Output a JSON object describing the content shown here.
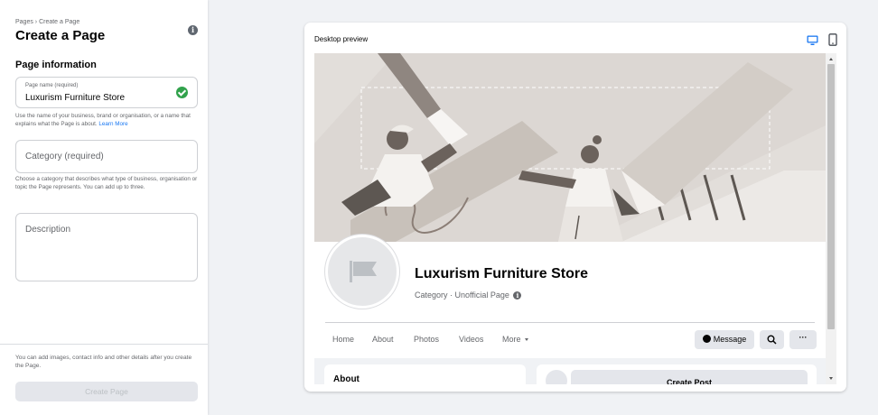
{
  "left_panel": {
    "breadcrumb": "Pages › Create a Page",
    "title": "Create a Page",
    "section_title": "Page information",
    "name_field": {
      "label": "Page name (required)",
      "value": "Luxurism Furniture Store"
    },
    "name_help": "Use the name of your business, brand or organisation, or a name that explains what the Page is about.",
    "learn_more": "Learn More",
    "category_field": {
      "placeholder": "Category (required)"
    },
    "category_help": "Choose a category that describes what type of business, organisation or topic the Page represents. You can add up to three.",
    "description_field": {
      "placeholder": "Description"
    },
    "footer_note": "You can add images, contact info and other details after you create the Page.",
    "create_button": "Create Page"
  },
  "preview": {
    "label": "Desktop preview",
    "page_name": "Luxurism Furniture Store",
    "page_category": "Category · Unofficial Page",
    "tabs": [
      "Home",
      "About",
      "Photos",
      "Videos",
      "More"
    ],
    "message_button": "Message",
    "about_title": "About",
    "create_post": "Create Post"
  },
  "colors": {
    "accent": "#1877f2",
    "success": "#31a24c",
    "cover_background": "#e2deda"
  }
}
